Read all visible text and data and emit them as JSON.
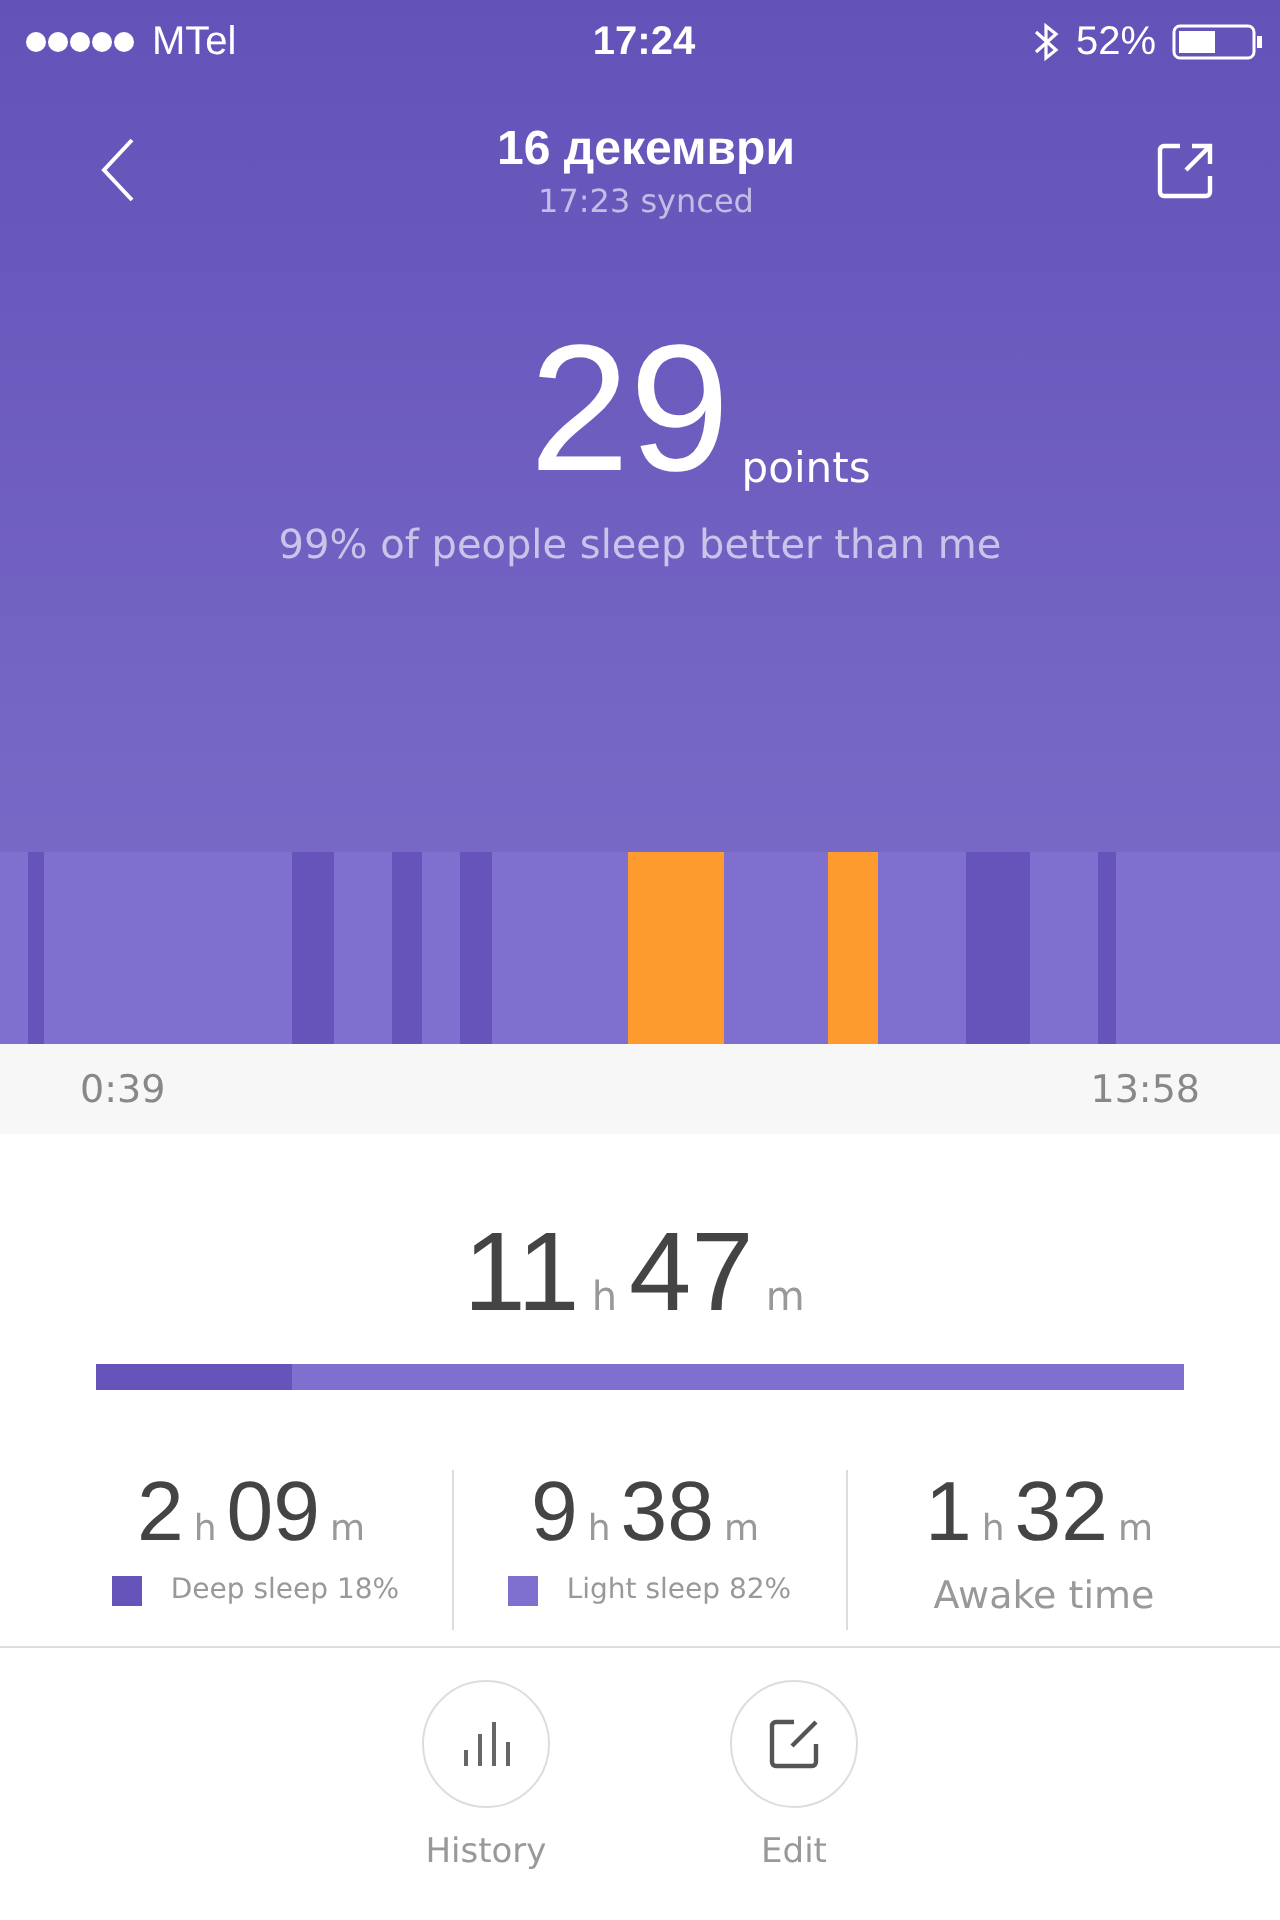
{
  "status_bar": {
    "carrier": "MTel",
    "time": "17:24",
    "battery": "52%"
  },
  "header": {
    "title": "16 декември",
    "subtitle": "17:23 synced"
  },
  "score": {
    "value": "29",
    "unit": "points",
    "comparison": "99% of people sleep better than me"
  },
  "timeline": {
    "start": "0:39",
    "end": "13:58"
  },
  "total": {
    "hours": "11",
    "h_unit": "h",
    "minutes": "47",
    "m_unit": "m",
    "deep_share": {
      "level": 0.18
    }
  },
  "stats": [
    {
      "kind": "deep",
      "hours": "2",
      "h_unit": "h",
      "minutes": "09",
      "m_unit": "m",
      "label": "Deep sleep 18%",
      "color": "#6654bb"
    },
    {
      "kind": "light",
      "hours": "9",
      "h_unit": "h",
      "minutes": "38",
      "m_unit": "m",
      "label": "Light sleep 82%",
      "color": "#7f70d0"
    },
    {
      "kind": "awake",
      "hours": "1",
      "h_unit": "h",
      "minutes": "32",
      "m_unit": "m",
      "label": "Awake time"
    }
  ],
  "actions": [
    {
      "kind": "history",
      "label": "History"
    },
    {
      "kind": "edit",
      "label": "Edit"
    }
  ]
}
